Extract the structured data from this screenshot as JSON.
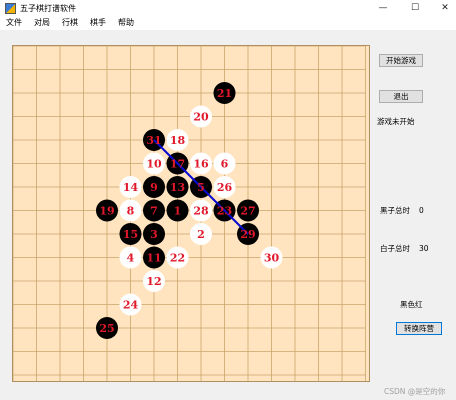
{
  "window": {
    "title": "五子棋打谱软件",
    "controls": {
      "minimize": "—",
      "maximize": "☐",
      "close": "✕"
    }
  },
  "menu": [
    "文件",
    "对局",
    "行棋",
    "棋手",
    "帮助"
  ],
  "board": {
    "grid_size": 15,
    "colors": {
      "background": "#ffe4bf",
      "grid": "#c9a56b",
      "black_stone": "#000000",
      "white_stone": "#ffffff",
      "number": "#e0182a",
      "win_line": "#0a0ad0"
    },
    "win_line": {
      "from": {
        "row": 4,
        "col": 6
      },
      "to": {
        "row": 8,
        "col": 10
      }
    },
    "stones": [
      {
        "n": 1,
        "color": "black",
        "row": 7,
        "col": 7
      },
      {
        "n": 2,
        "color": "white",
        "row": 8,
        "col": 8
      },
      {
        "n": 3,
        "color": "black",
        "row": 8,
        "col": 6
      },
      {
        "n": 4,
        "color": "white",
        "row": 9,
        "col": 5
      },
      {
        "n": 5,
        "color": "black",
        "row": 6,
        "col": 8
      },
      {
        "n": 6,
        "color": "white",
        "row": 5,
        "col": 9
      },
      {
        "n": 7,
        "color": "black",
        "row": 7,
        "col": 6
      },
      {
        "n": 8,
        "color": "white",
        "row": 7,
        "col": 5
      },
      {
        "n": 9,
        "color": "black",
        "row": 6,
        "col": 6
      },
      {
        "n": 10,
        "color": "white",
        "row": 5,
        "col": 6
      },
      {
        "n": 11,
        "color": "black",
        "row": 9,
        "col": 6
      },
      {
        "n": 12,
        "color": "white",
        "row": 10,
        "col": 6
      },
      {
        "n": 13,
        "color": "black",
        "row": 6,
        "col": 7
      },
      {
        "n": 14,
        "color": "white",
        "row": 6,
        "col": 5
      },
      {
        "n": 15,
        "color": "black",
        "row": 8,
        "col": 5
      },
      {
        "n": 16,
        "color": "white",
        "row": 5,
        "col": 8
      },
      {
        "n": 17,
        "color": "black",
        "row": 5,
        "col": 7
      },
      {
        "n": 18,
        "color": "white",
        "row": 4,
        "col": 7
      },
      {
        "n": 19,
        "color": "black",
        "row": 7,
        "col": 4
      },
      {
        "n": 20,
        "color": "white",
        "row": 3,
        "col": 8
      },
      {
        "n": 21,
        "color": "black",
        "row": 2,
        "col": 9
      },
      {
        "n": 22,
        "color": "white",
        "row": 9,
        "col": 7
      },
      {
        "n": 23,
        "color": "black",
        "row": 7,
        "col": 9
      },
      {
        "n": 24,
        "color": "white",
        "row": 11,
        "col": 5
      },
      {
        "n": 25,
        "color": "black",
        "row": 12,
        "col": 4
      },
      {
        "n": 26,
        "color": "white",
        "row": 6,
        "col": 9
      },
      {
        "n": 27,
        "color": "black",
        "row": 7,
        "col": 10
      },
      {
        "n": 28,
        "color": "white",
        "row": 7,
        "col": 8
      },
      {
        "n": 29,
        "color": "black",
        "row": 8,
        "col": 10
      },
      {
        "n": 30,
        "color": "white",
        "row": 9,
        "col": 11
      },
      {
        "n": 31,
        "color": "black",
        "row": 4,
        "col": 6
      }
    ]
  },
  "panel": {
    "start_button": "开始游戏",
    "exit_button": "退出",
    "status": "游戏未开始",
    "black_time_label": "黑子总时",
    "black_time_value": "0",
    "white_time_label": "白子总时",
    "white_time_value": "30",
    "turn_text": "黑色红",
    "swap_button": "转换阵营"
  },
  "watermark": "CSDN @是空的你"
}
